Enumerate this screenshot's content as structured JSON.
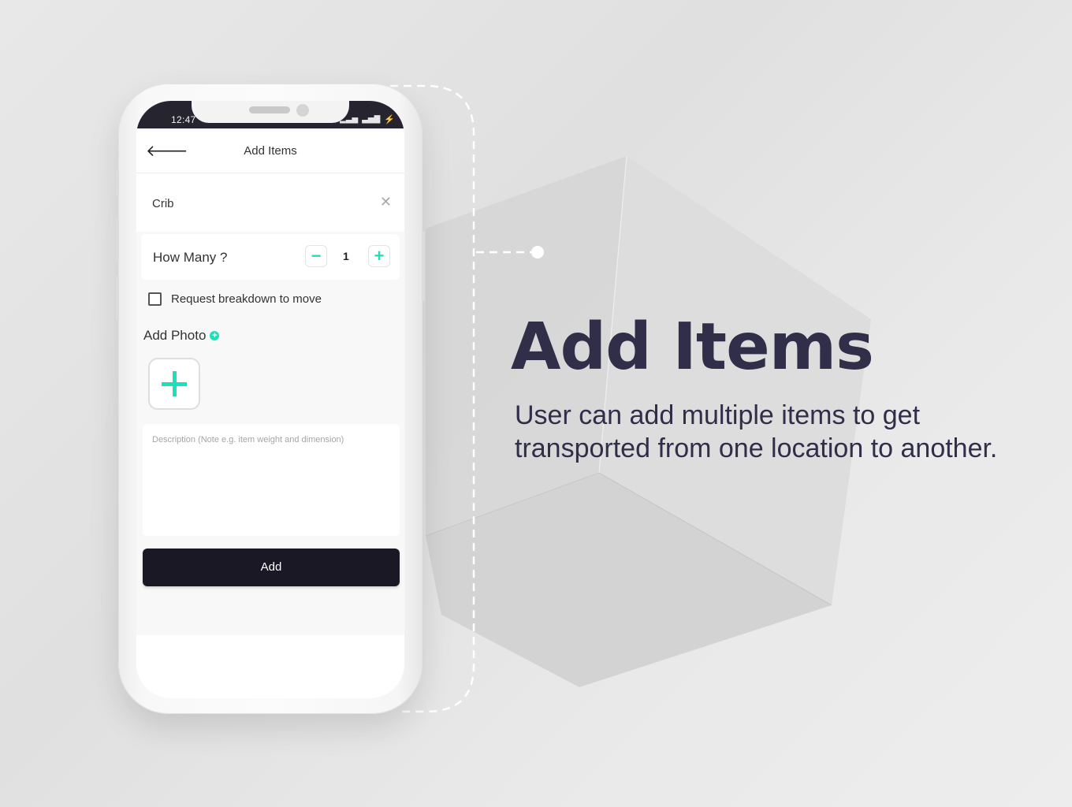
{
  "status_bar": {
    "time": "12:47",
    "icons": [
      "check-icon",
      "data-icon",
      "signal-icon",
      "4g-signal-icon",
      "charging-icon"
    ]
  },
  "app_bar": {
    "back_icon": "arrow-left-icon",
    "title": "Add Items"
  },
  "item": {
    "name": "Crib",
    "clear_icon": "close-icon"
  },
  "quantity": {
    "label": "How Many ?",
    "value": "1",
    "minus_label": "−",
    "plus_label": "+"
  },
  "breakdown": {
    "label": "Request breakdown to move",
    "checked": false
  },
  "photo": {
    "label": "Add Photo",
    "small_plus": "+"
  },
  "description": {
    "placeholder": "Description (Note e.g. item weight and dimension)",
    "value": ""
  },
  "add_button": {
    "label": "Add"
  },
  "marketing": {
    "headline": "Add Items",
    "subtext": "User can add multiple items to get transported from one location to another."
  },
  "colors": {
    "accent": "#1de0b8",
    "dark": "#1b1825",
    "headline": "#302e48",
    "status_bar": "#26242f"
  }
}
